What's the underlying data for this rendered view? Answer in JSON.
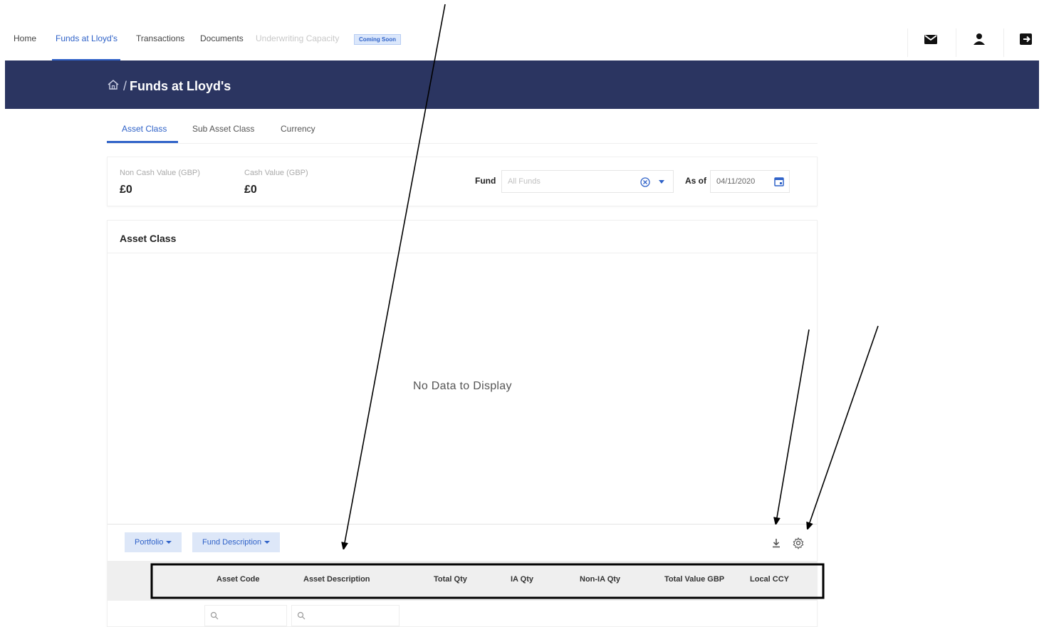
{
  "nav": {
    "items": [
      "Home",
      "Funds at Lloyd's",
      "Transactions",
      "Documents",
      "Underwriting Capacity"
    ],
    "badge": "Coming Soon",
    "icons": [
      "mail-icon",
      "user-icon",
      "logout-icon"
    ]
  },
  "header": {
    "separator": "/",
    "title": "Funds at Lloyd's"
  },
  "tabs": [
    "Asset Class",
    "Sub Asset Class",
    "Currency"
  ],
  "summary": {
    "non_cash_label": "Non Cash Value (GBP)",
    "non_cash_value": "£0",
    "cash_label": "Cash Value (GBP)",
    "cash_value": "£0",
    "fund_label": "Fund",
    "fund_placeholder": "All Funds",
    "asof_label": "As of",
    "asof_value": "04/11/2020"
  },
  "panel": {
    "title": "Asset Class",
    "empty_message": "No Data to Display",
    "group_chips": [
      "Portfolio",
      "Fund Description"
    ],
    "columns": [
      "Asset Code",
      "Asset Description",
      "Total Qty",
      "IA Qty",
      "Non-IA Qty",
      "Total Value GBP",
      "Local CCY"
    ]
  },
  "colors": {
    "accent": "#2f62c8",
    "header_band": "#2b3561",
    "annotation": "#000000"
  }
}
